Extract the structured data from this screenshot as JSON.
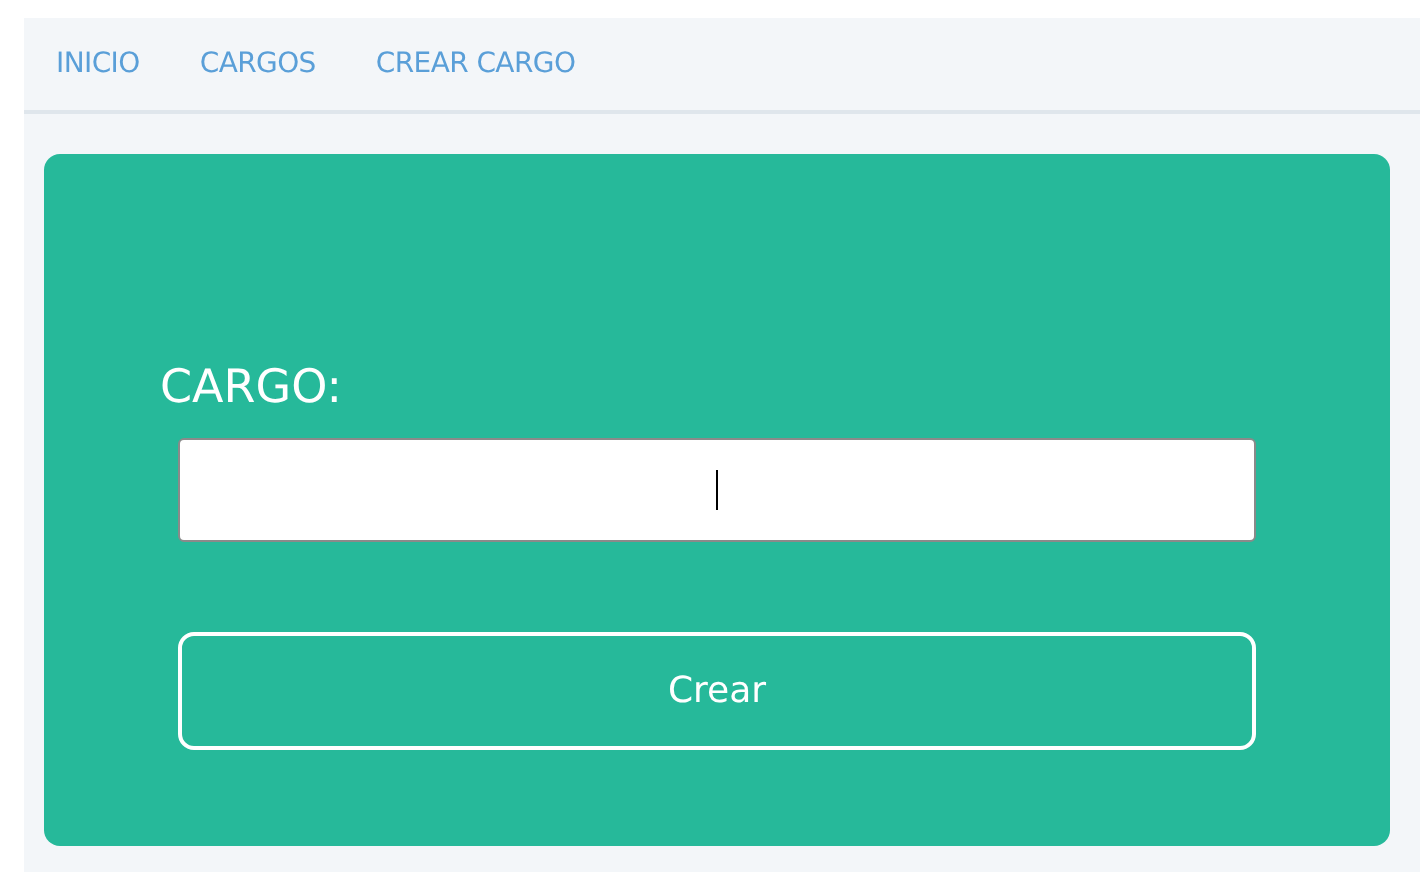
{
  "nav": {
    "items": [
      {
        "label": "INICIO"
      },
      {
        "label": "CARGOS"
      },
      {
        "label": "CREAR CARGO"
      }
    ]
  },
  "form": {
    "label": "CARGO:",
    "field": {
      "focused": true
    },
    "button": "Crear"
  }
}
